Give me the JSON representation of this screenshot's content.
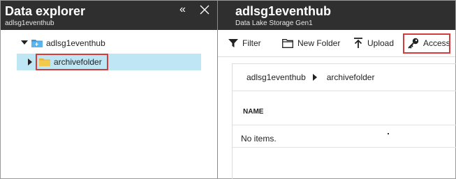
{
  "left_panel": {
    "title": "Data explorer",
    "subtitle": "adlsg1eventhub",
    "collapse_glyph": "«",
    "close_icon": "close-icon",
    "tree": {
      "root": {
        "label": "adlsg1eventhub",
        "icon": "storage-folder-icon",
        "expanded": true
      },
      "children": [
        {
          "label": "archivefolder",
          "icon": "folder-icon",
          "selected": true,
          "expanded": false
        }
      ]
    }
  },
  "right_panel": {
    "title": "adlsg1eventhub",
    "subtitle": "Data Lake Storage Gen1",
    "toolbar": {
      "filter_label": "Filter",
      "new_folder_label": "New Folder",
      "upload_label": "Upload",
      "access_label": "Access"
    },
    "breadcrumb": {
      "root": "adlsg1eventhub",
      "current": "archivefolder"
    },
    "table": {
      "columns": [
        "NAME"
      ],
      "empty_text": "No items."
    }
  },
  "colors": {
    "header_bg": "#2f2f2f",
    "selection_bg": "#bfe6f5",
    "highlight_border": "#d43b3b",
    "folder_yellow": "#f2c94c",
    "storage_blue": "#3a96dd"
  }
}
